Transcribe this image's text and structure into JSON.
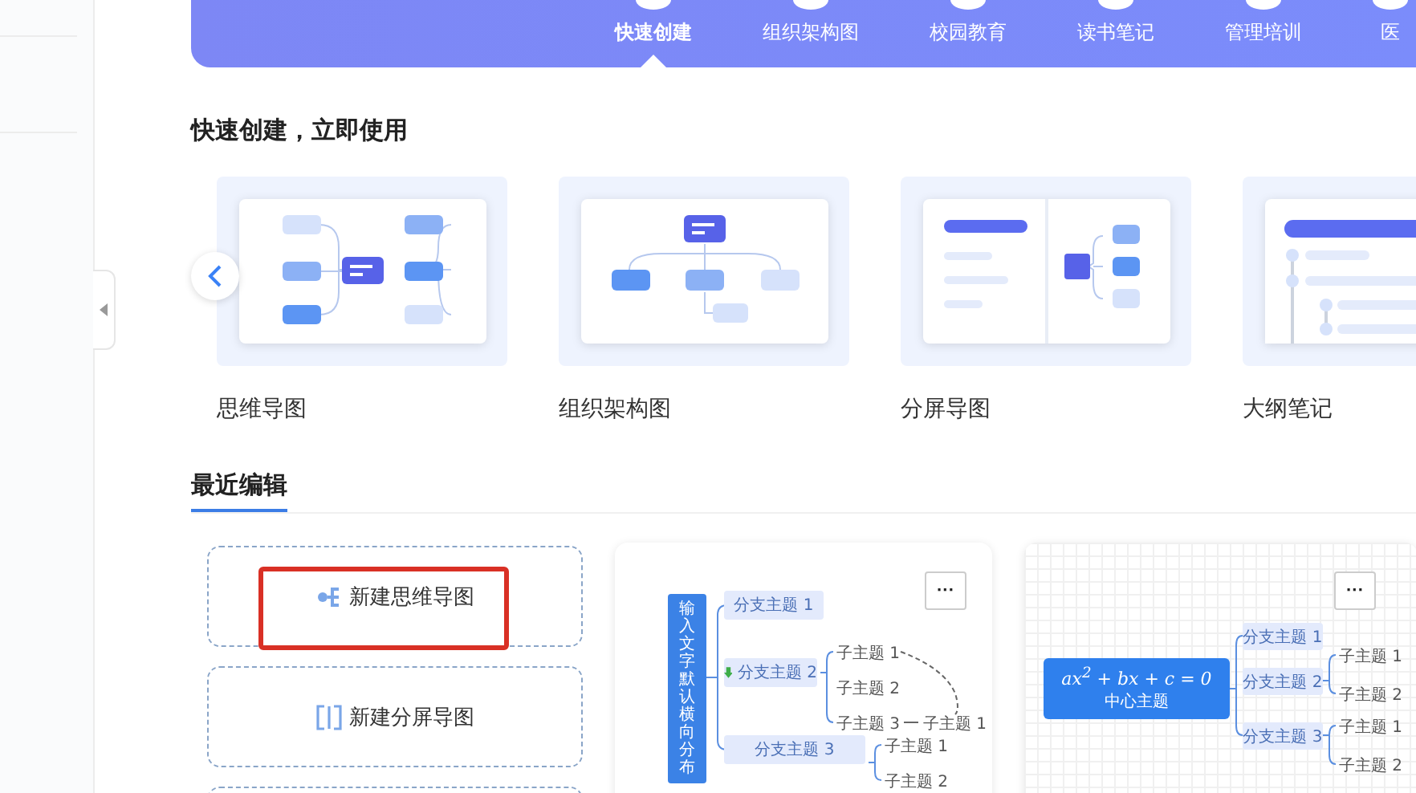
{
  "banner": {
    "tabs": [
      {
        "label": "快速创建",
        "selected": true
      },
      {
        "label": "组织架构图",
        "selected": false
      },
      {
        "label": "校园教育",
        "selected": false
      },
      {
        "label": "读书笔记",
        "selected": false
      },
      {
        "label": "管理培训",
        "selected": false
      },
      {
        "label": "医",
        "selected": false
      }
    ]
  },
  "quick_create": {
    "title": "快速创建，立即使用",
    "templates": [
      {
        "label": "思维导图",
        "kind": "mindmap"
      },
      {
        "label": "组织架构图",
        "kind": "org"
      },
      {
        "label": "分屏导图",
        "kind": "split"
      },
      {
        "label": "大纲笔记",
        "kind": "outline"
      }
    ]
  },
  "recent": {
    "title": "最近编辑",
    "new_items": [
      {
        "label": "新建思维导图",
        "kind": "mindmap",
        "highlighted": true
      },
      {
        "label": "新建分屏导图",
        "kind": "split",
        "highlighted": false
      }
    ],
    "files": [
      {
        "kind": "vertical",
        "more": "···",
        "root": "输入文字默认横向分布",
        "branches": [
          {
            "label": "分支主题 1",
            "arrow": false
          },
          {
            "label": "分支主题 2",
            "arrow": true,
            "children": [
              {
                "label": "子主题 1"
              },
              {
                "label": "子主题 2"
              },
              {
                "label": "子主题 3",
                "link": "子主题 1"
              }
            ]
          },
          {
            "label": "分支主题 3",
            "arrow": false,
            "children": [
              {
                "label": "子主题 1"
              },
              {
                "label": "子主题 2"
              }
            ]
          }
        ]
      },
      {
        "kind": "formula",
        "more": "···",
        "formula": "ax$^{2}$ + bx + c = 0",
        "root": "中心主题",
        "branches": [
          {
            "label": "分支主题 1"
          },
          {
            "label": "分支主题 2",
            "children": [
              {
                "label": "子主题 1"
              },
              {
                "label": "子主题 2"
              }
            ]
          },
          {
            "label": "分支主题 3",
            "children": [
              {
                "label": "子主题 1"
              },
              {
                "label": "子主题 2"
              }
            ]
          }
        ]
      }
    ]
  }
}
